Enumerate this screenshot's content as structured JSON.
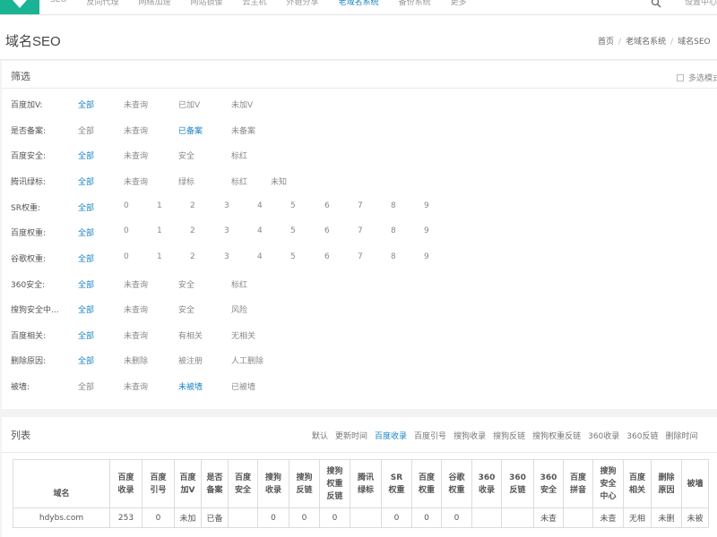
{
  "nav": {
    "items": [
      "SEO",
      "反向代理",
      "网络加速",
      "网站镜像",
      "云主机",
      "外链分享",
      "老域名系统",
      "备份系统",
      "更多"
    ],
    "active_index": 6,
    "user": "设置中心"
  },
  "page": {
    "title": "域名SEO",
    "breadcrumb": [
      "首页",
      "老域名系统",
      "域名SEO"
    ]
  },
  "filter": {
    "title": "筛选",
    "multi_label": "多选模式",
    "rows": [
      {
        "label": "百度加V:",
        "options": [
          "全部",
          "未查询",
          "已加V",
          "未加V"
        ],
        "selected": 0
      },
      {
        "label": "是否备案:",
        "options": [
          "全部",
          "未查询",
          "已备案",
          "未备案"
        ],
        "selected": 2
      },
      {
        "label": "百度安全:",
        "options": [
          "全部",
          "未查询",
          "安全",
          "标红"
        ],
        "selected": 0
      },
      {
        "label": "腾讯绿标:",
        "options": [
          "全部",
          "未查询",
          "绿标",
          "标红",
          "未知"
        ],
        "selected": 0
      },
      {
        "label": "SR权重:",
        "options": [
          "全部",
          "0",
          "1",
          "2",
          "3",
          "4",
          "5",
          "6",
          "7",
          "8",
          "9"
        ],
        "selected": 0
      },
      {
        "label": "百度权重:",
        "options": [
          "全部",
          "0",
          "1",
          "2",
          "3",
          "4",
          "5",
          "6",
          "7",
          "8",
          "9"
        ],
        "selected": 0
      },
      {
        "label": "谷歌权重:",
        "options": [
          "全部",
          "0",
          "1",
          "2",
          "3",
          "4",
          "5",
          "6",
          "7",
          "8",
          "9"
        ],
        "selected": 0
      },
      {
        "label": "360安全:",
        "options": [
          "全部",
          "未查询",
          "安全",
          "标红"
        ],
        "selected": 0
      },
      {
        "label": "搜狗安全中...",
        "options": [
          "全部",
          "未查询",
          "安全",
          "风险"
        ],
        "selected": 0
      },
      {
        "label": "百度相关:",
        "options": [
          "全部",
          "未查询",
          "有相关",
          "无相关"
        ],
        "selected": 0
      },
      {
        "label": "删除原因:",
        "options": [
          "全部",
          "未删除",
          "被注册",
          "人工删除"
        ],
        "selected": 0
      },
      {
        "label": "被墙:",
        "options": [
          "全部",
          "未查询",
          "未被墙",
          "已被墙"
        ],
        "selected": 2
      }
    ]
  },
  "list": {
    "title": "列表",
    "sort_options": [
      "默认",
      "更新时间",
      "百度收录",
      "百度引号",
      "搜狗收录",
      "搜狗反链",
      "搜狗权重反链",
      "360收录",
      "360反链",
      "删除时间"
    ],
    "sort_selected": 2,
    "columns": [
      "域名",
      "百度收录",
      "百度引号",
      "百度加V",
      "是否备案",
      "百度安全",
      "搜狗收录",
      "搜狗反链",
      "搜狗权重反链",
      "腾讯绿标",
      "SR权重",
      "百度权重",
      "谷歌权重",
      "360收录",
      "360反链",
      "360安全",
      "百度拼音",
      "搜狗安全中心",
      "百度相关",
      "删除原因",
      "被墙"
    ],
    "rows": [
      [
        "hdybs.com",
        "253",
        "0",
        "未加",
        "已备",
        "",
        "0",
        "0",
        "0",
        "",
        "0",
        "0",
        "0",
        "",
        "",
        "未查",
        "",
        "未查",
        "无相",
        "未删",
        "未被"
      ]
    ]
  }
}
